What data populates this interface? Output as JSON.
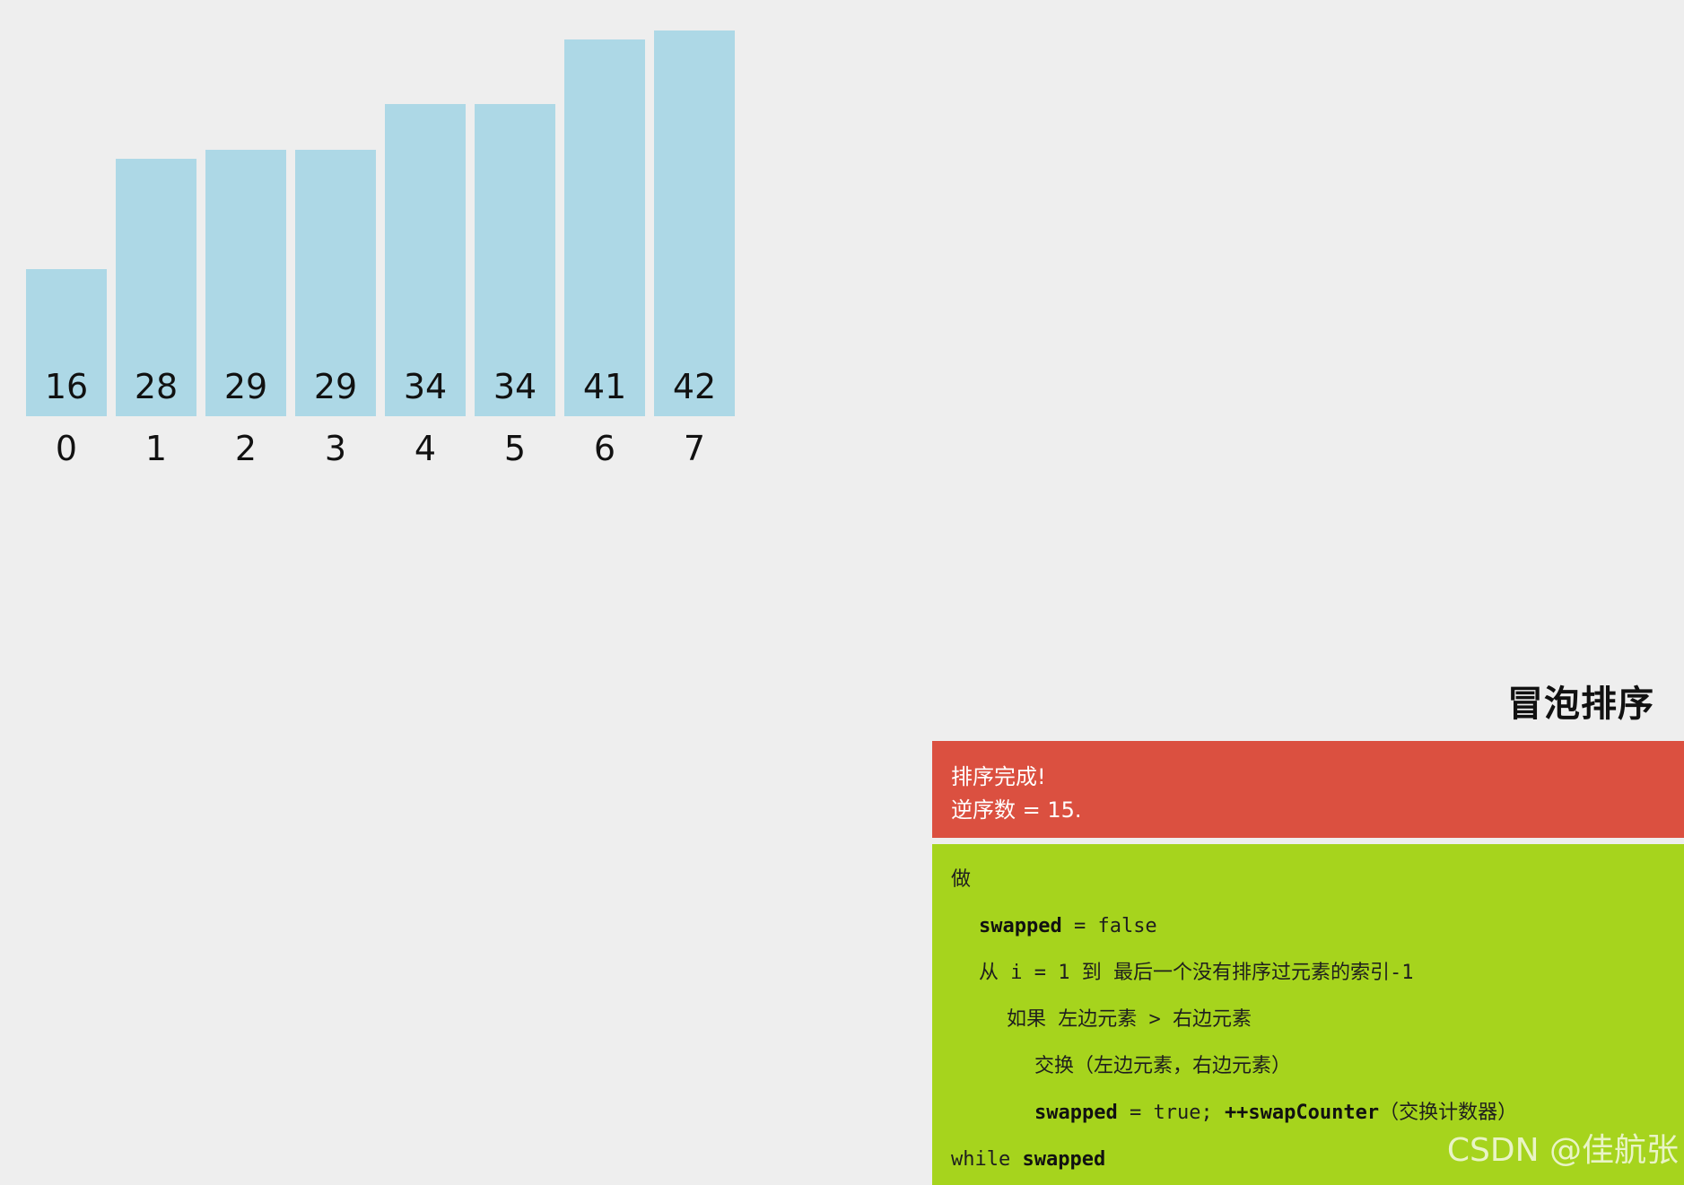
{
  "chart_data": {
    "type": "bar",
    "categories": [
      "0",
      "1",
      "2",
      "3",
      "4",
      "5",
      "6",
      "7"
    ],
    "values": [
      16,
      28,
      29,
      29,
      34,
      34,
      41,
      42
    ],
    "ylim": [
      0,
      43
    ],
    "bar_color": "#add8e6",
    "grid": false,
    "title": "",
    "xlabel": "",
    "ylabel": ""
  },
  "algorithm": {
    "title": "冒泡排序"
  },
  "status": {
    "line1": "排序完成!",
    "line2": "逆序数 = 15."
  },
  "pseudocode": {
    "lines": [
      {
        "indent": 0,
        "parts": [
          {
            "text": "做",
            "bold": false
          }
        ]
      },
      {
        "indent": 1,
        "parts": [
          {
            "text": "swapped",
            "bold": true
          },
          {
            "text": " = false",
            "bold": false
          }
        ]
      },
      {
        "indent": 1,
        "parts": [
          {
            "text": "从 i = 1 到 最后一个没有排序过元素的索引-1",
            "bold": false
          }
        ]
      },
      {
        "indent": 2,
        "parts": [
          {
            "text": "如果 左边元素 > 右边元素",
            "bold": false
          }
        ]
      },
      {
        "indent": 3,
        "parts": [
          {
            "text": "交换（左边元素，右边元素）",
            "bold": false
          }
        ]
      },
      {
        "indent": 3,
        "parts": [
          {
            "text": "swapped",
            "bold": true
          },
          {
            "text": " = true; ",
            "bold": false
          },
          {
            "text": "++swapCounter",
            "bold": true
          },
          {
            "text": "（交换计数器）",
            "bold": false
          }
        ]
      },
      {
        "indent": 0,
        "parts": [
          {
            "text": "while ",
            "bold": false
          },
          {
            "text": "swapped",
            "bold": true
          }
        ]
      }
    ]
  },
  "watermark": "CSDN @佳航张",
  "colors": {
    "background": "#eeeeee",
    "status_panel": "#db5040",
    "code_panel": "#a6d41d"
  }
}
